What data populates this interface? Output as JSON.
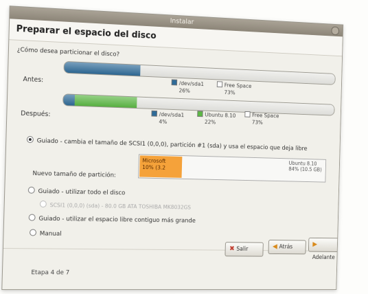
{
  "window": {
    "title": "Instalar"
  },
  "header": {
    "title": "Preparar el espacio del disco"
  },
  "question": "¿Cómo desea particionar el disco?",
  "before": {
    "label": "Antes:",
    "legend": [
      {
        "name": "/dev/sda1",
        "percent": "26%",
        "color": "#2f6b98"
      },
      {
        "name": "Free Space",
        "percent": "73%",
        "color": "#ffffff"
      }
    ],
    "fractions": [
      0.27,
      0.73
    ],
    "colors": [
      "#2f6b98",
      "#e8e8e4"
    ]
  },
  "after": {
    "label": "Después:",
    "legend": [
      {
        "name": "/dev/sda1",
        "percent": "4%",
        "color": "#2f6b98"
      },
      {
        "name": "Ubuntu 8.10",
        "percent": "22%",
        "color": "#5cb844"
      },
      {
        "name": "Free Space",
        "percent": "73%",
        "color": "#ffffff"
      }
    ],
    "fractions": [
      0.04,
      0.22,
      0.74
    ],
    "colors": [
      "#2f6b98",
      "#5cb844",
      "#e8e8e4"
    ]
  },
  "options": [
    {
      "label": "Guiado - cambia el tamaño de SCSI1 (0,0,0), partición #1 (sda) y usa el espacio que deja libre",
      "selected": true
    },
    {
      "label": "Guiado - utilizar todo el disco",
      "selected": false
    },
    {
      "label": "SCSI1 (0,0,0) (sda) - 80.0 GB ATA TOSHIBA MK8032GS",
      "selected": false,
      "disabled": true
    },
    {
      "label": "Guiado - utilizar el espacio libre contiguo más grande",
      "selected": false
    },
    {
      "label": "Manual",
      "selected": false
    }
  ],
  "resize": {
    "label": "Nuevo tamaño de partición:",
    "left_title": "Microsoft",
    "left_value": "10% (3.2",
    "right_title": "Ubuntu 8.10",
    "right_value": "84% (10.5 GB)",
    "left_fraction": 0.22
  },
  "buttons": {
    "quit": "Salir",
    "back": "Atrás",
    "forward": "Adelante"
  },
  "step": "Etapa 4 de 7"
}
